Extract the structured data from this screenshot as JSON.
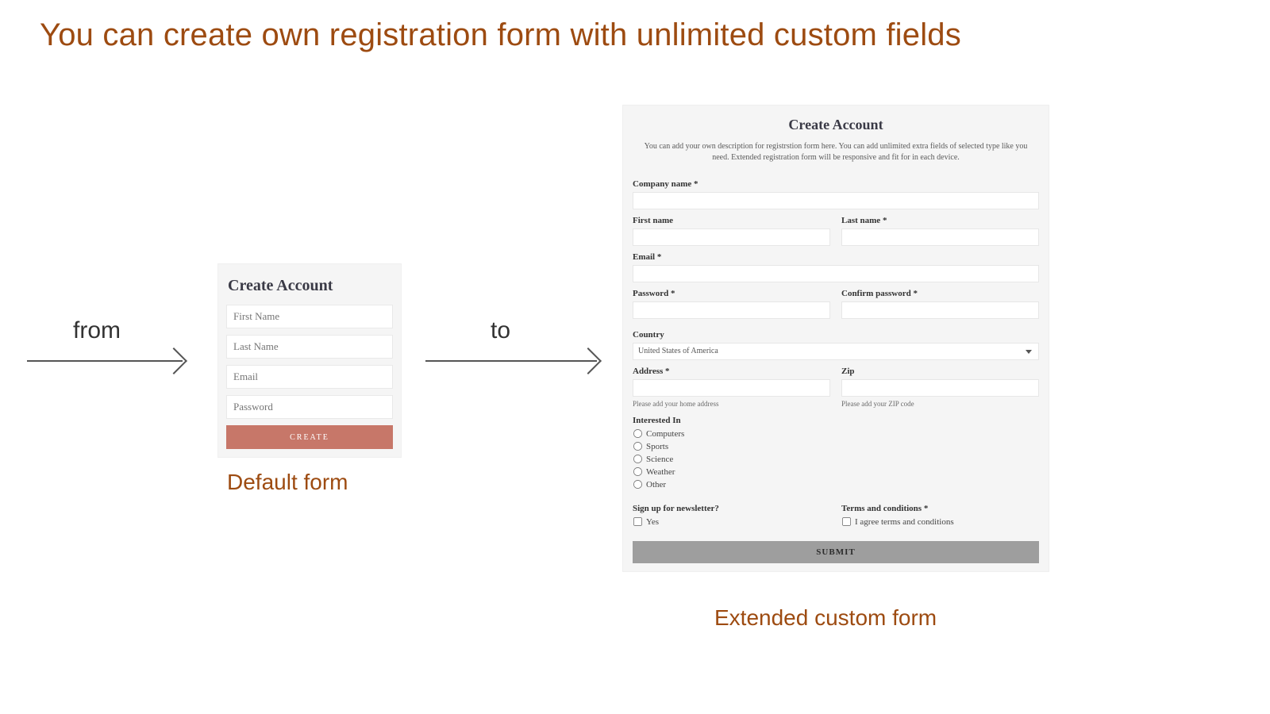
{
  "headline": "You can create own registration form with unlimited custom fields",
  "labels": {
    "from": "from",
    "to": "to"
  },
  "captions": {
    "default": "Default form",
    "extended": "Extended custom form"
  },
  "default_form": {
    "title": "Create Account",
    "first_name_ph": "First Name",
    "last_name_ph": "Last Name",
    "email_ph": "Email",
    "password_ph": "Password",
    "submit": "CREATE"
  },
  "ext_form": {
    "title": "Create Account",
    "description": "You can add your own description for registrstion form here. You can add unlimited extra fields of selected type like you need. Extended registration form will be responsive and fit for in each device.",
    "company_label": "Company name *",
    "first_name_label": "First name",
    "last_name_label": "Last name *",
    "email_label": "Email *",
    "password_label": "Password *",
    "confirm_password_label": "Confirm password *",
    "country_label": "Country",
    "country_value": "United States of America",
    "address_label": "Address *",
    "address_hint": "Please add your home address",
    "zip_label": "Zip",
    "zip_hint": "Please add your ZIP code",
    "interested_label": "Interested In",
    "interested_options": [
      "Computers",
      "Sports",
      "Science",
      "Weather",
      "Other"
    ],
    "newsletter_label": "Sign up for newsletter?",
    "newsletter_option": "Yes",
    "terms_label": "Terms and conditions *",
    "terms_option": "I agree terms and conditions",
    "submit": "SUBMIT"
  }
}
